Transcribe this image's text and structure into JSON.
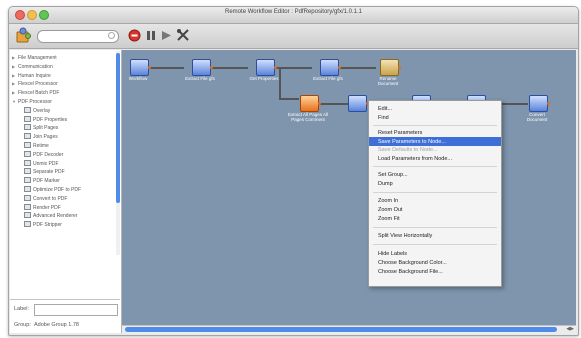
{
  "window": {
    "title": "Remote Workflow Editor : PdfRepository/gfx/1.0.1.1",
    "traffic_lights": [
      "#ed6a5e",
      "#f5bf4f",
      "#61c554"
    ]
  },
  "toolbar": {
    "search_value": "",
    "icons": [
      "puzzle-icon",
      "clear-icon",
      "stop-icon",
      "pause-icon",
      "play-icon",
      "tools-icon"
    ]
  },
  "sidebar": {
    "categories": [
      {
        "label": "File Management",
        "expanded": false
      },
      {
        "label": "Communication",
        "expanded": false
      },
      {
        "label": "Human Inquire",
        "expanded": false
      },
      {
        "label": "Flexcel Processor",
        "expanded": false
      },
      {
        "label": "Flexcel Batch PDF",
        "expanded": false
      },
      {
        "label": "PDF Processor",
        "expanded": true
      }
    ],
    "items": [
      "Overlay",
      "PDF Properties",
      "Split Pages",
      "Join Pages",
      "Retime",
      "PDF Decoder",
      "Unmix PDF",
      "Separate PDF",
      "PDF Marker",
      "Optimize PDF to PDF",
      "Convert to PDF",
      "Render PDF",
      "Advanced Renderer",
      "PDF Stripper"
    ],
    "label_caption": "Label:",
    "label_value": "",
    "group_caption": "Group:",
    "group_value": "Adobe Group 1.78"
  },
  "canvas": {
    "nodes_row1": [
      "Workflow",
      "Extract File gfx",
      "Get Properties",
      "Extract File gfx",
      "Rename Document"
    ],
    "nodes_row2": [
      "Extract All Pages All Pages Comment",
      "",
      "",
      "",
      "Convert Document"
    ]
  },
  "context_menu": {
    "items": [
      {
        "label": "Edit...",
        "state": "normal"
      },
      {
        "label": "Find",
        "state": "normal"
      },
      {
        "separator": true
      },
      {
        "label": "Reset Parameters",
        "state": "normal"
      },
      {
        "label": "Save Parameters to Node...",
        "state": "selected"
      },
      {
        "label": "Save Defaults to Node...",
        "state": "disabled"
      },
      {
        "label": "Load Parameters from Node...",
        "state": "normal"
      },
      {
        "separator": true
      },
      {
        "label": "Set Group...",
        "state": "normal"
      },
      {
        "label": "Dump",
        "state": "normal"
      },
      {
        "separator": true
      },
      {
        "label": "Zoom In",
        "state": "normal"
      },
      {
        "label": "Zoom Out",
        "state": "normal"
      },
      {
        "label": "Zoom Fit",
        "state": "normal"
      },
      {
        "separator": true
      },
      {
        "label": "Split View Horizontally",
        "state": "normal"
      },
      {
        "separator": true
      },
      {
        "label": "Hide Labels",
        "state": "normal"
      },
      {
        "label": "Choose Background Color...",
        "state": "normal"
      },
      {
        "label": "Choose Background File...",
        "state": "normal"
      }
    ]
  }
}
